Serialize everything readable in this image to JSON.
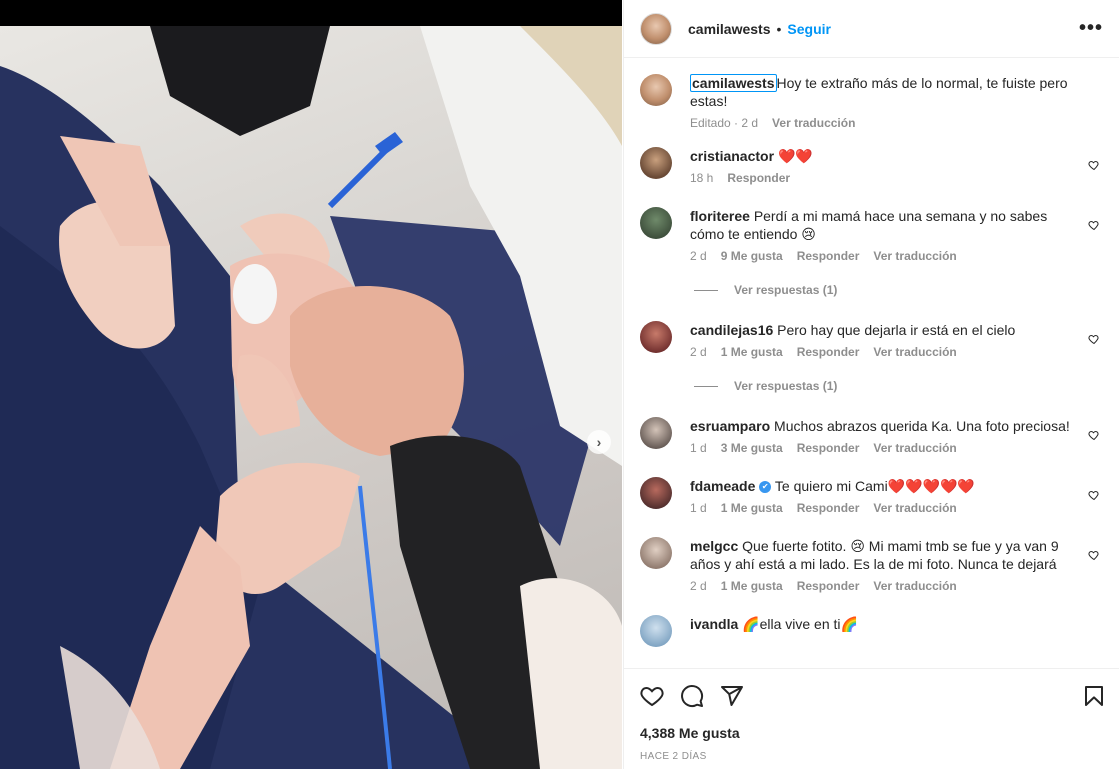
{
  "post": {
    "username": "camilawests",
    "follow_label": "Seguir",
    "more_label": "•••",
    "next_label": "›"
  },
  "caption": {
    "username": "camilawests",
    "text": "Hoy te extraño más de lo normal, te fuiste pero estas!",
    "edited": "Editado · 2 d",
    "translate": "Ver traducción"
  },
  "comments": [
    {
      "username": "cristianactor",
      "text": "❤️❤️",
      "time": "18 h",
      "likes": "",
      "reply": "Responder",
      "translate": ""
    },
    {
      "username": "floriteree",
      "text": "Perdí a mi mamá hace una semana y no sabes cómo te entiendo 😢",
      "time": "2 d",
      "likes": "9 Me gusta",
      "reply": "Responder",
      "translate": "Ver traducción",
      "replies": "Ver respuestas (1)"
    },
    {
      "username": "candilejas16",
      "text": "Pero hay que dejarla ir está en el cielo",
      "time": "2 d",
      "likes": "1 Me gusta",
      "reply": "Responder",
      "translate": "Ver traducción",
      "replies": "Ver respuestas (1)"
    },
    {
      "username": "esruamparo",
      "text": "Muchos abrazos querida Ka. Una foto preciosa!",
      "time": "1 d",
      "likes": "3 Me gusta",
      "reply": "Responder",
      "translate": "Ver traducción"
    },
    {
      "username": "fdameade",
      "verified": "✔",
      "text": "Te quiero mi Cami❤️❤️❤️❤️❤️",
      "time": "1 d",
      "likes": "1 Me gusta",
      "reply": "Responder",
      "translate": "Ver traducción"
    },
    {
      "username": "melgcc",
      "text": "Que fuerte fotito. 😢 Mi mami tmb se fue y ya van 9 años y ahí está a mi lado. Es la de mi foto. Nunca te dejará",
      "time": "2 d",
      "likes": "1 Me gusta",
      "reply": "Responder",
      "translate": "Ver traducción"
    },
    {
      "username": "ivandla",
      "text": "🌈ella vive en ti🌈"
    }
  ],
  "footer": {
    "likes": "4,388 Me gusta",
    "ago": "HACE 2 DÍAS"
  },
  "colors": {
    "accent": "#0095f6",
    "muted": "#8e8e8e",
    "verified": "#3897f0"
  }
}
